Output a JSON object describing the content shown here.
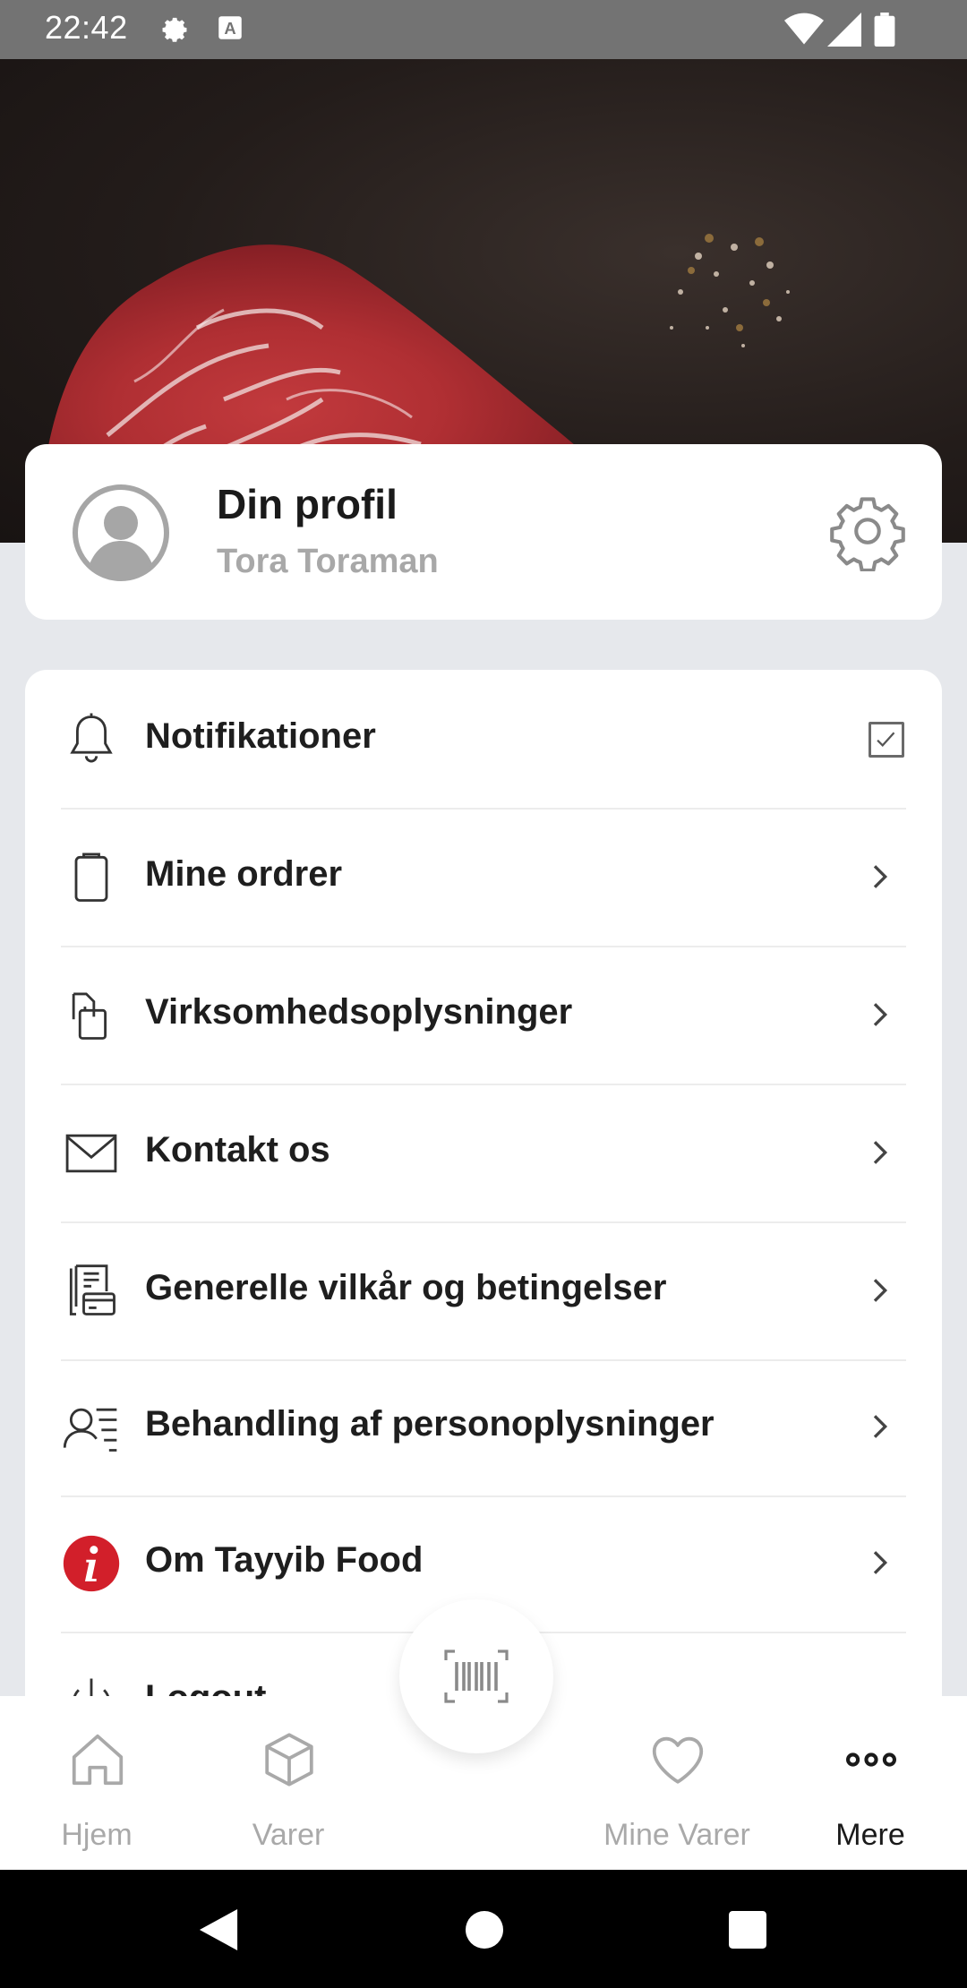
{
  "status_bar": {
    "time": "22:42"
  },
  "profile": {
    "title": "Din profil",
    "name": "Tora Toraman"
  },
  "menu": {
    "notifications": "Notifikationer",
    "orders": "Mine ordrer",
    "company_info": "Virksomhedsoplysninger",
    "contact": "Kontakt os",
    "terms": "Generelle vilkår og betingelser",
    "privacy": "Behandling af personoplysninger",
    "about": "Om Tayyib Food",
    "logout": "Logout"
  },
  "bottom_nav": {
    "home": "Hjem",
    "products": "Varer",
    "my_products": "Mine Varer",
    "more": "Mere"
  },
  "colors": {
    "accent_red": "#d21f2a",
    "card": "#ffffff",
    "background": "#e6e8ec"
  }
}
